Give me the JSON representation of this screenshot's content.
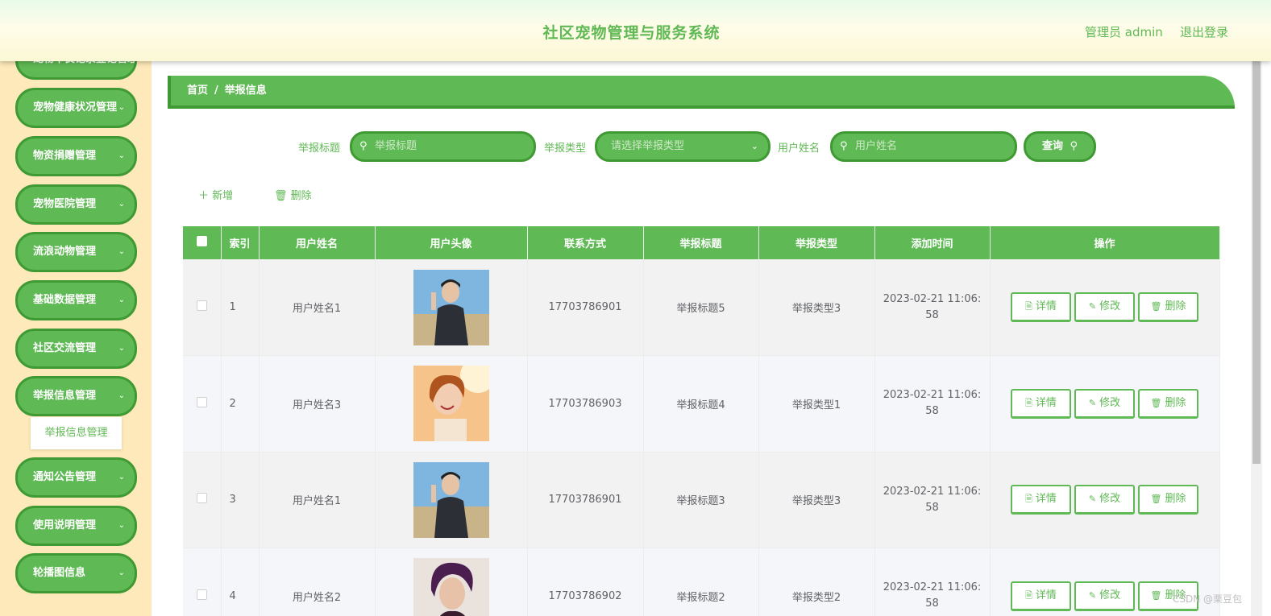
{
  "header": {
    "title": "社区宠物管理与服务系统",
    "admin": "管理员 admin",
    "logout": "退出登录"
  },
  "sidebar": {
    "items": [
      {
        "label": "宠物不良记录登记管理"
      },
      {
        "label": "宠物健康状况管理"
      },
      {
        "label": "物资捐赠管理"
      },
      {
        "label": "宠物医院管理"
      },
      {
        "label": "流浪动物管理"
      },
      {
        "label": "基础数据管理"
      },
      {
        "label": "社区交流管理"
      },
      {
        "label": "举报信息管理"
      },
      {
        "label": "通知公告管理"
      },
      {
        "label": "使用说明管理"
      },
      {
        "label": "轮播图信息"
      }
    ],
    "submenu": "举报信息管理"
  },
  "breadcrumb": {
    "home": "首页",
    "sep": "/",
    "current": "举报信息"
  },
  "search": {
    "title_label": "举报标题",
    "title_placeholder": "举报标题",
    "type_label": "举报类型",
    "type_placeholder": "请选择举报类型",
    "name_label": "用户姓名",
    "name_placeholder": "用户姓名",
    "query": "查询"
  },
  "actions": {
    "add": "新增",
    "delete": "删除"
  },
  "table": {
    "headers": [
      "索引",
      "用户姓名",
      "用户头像",
      "联系方式",
      "举报标题",
      "举报类型",
      "添加时间",
      "操作"
    ],
    "rows": [
      {
        "index": "1",
        "name": "用户姓名1",
        "phone": "17703786901",
        "title": "举报标题5",
        "type": "举报类型3",
        "time": "2023-02-21 11:06:58",
        "avatar": "avatar-1"
      },
      {
        "index": "2",
        "name": "用户姓名3",
        "phone": "17703786903",
        "title": "举报标题4",
        "type": "举报类型1",
        "time": "2023-02-21 11:06:58",
        "avatar": "avatar-3"
      },
      {
        "index": "3",
        "name": "用户姓名1",
        "phone": "17703786901",
        "title": "举报标题3",
        "type": "举报类型3",
        "time": "2023-02-21 11:06:58",
        "avatar": "avatar-1"
      },
      {
        "index": "4",
        "name": "用户姓名2",
        "phone": "17703786902",
        "title": "举报标题2",
        "type": "举报类型2",
        "time": "2023-02-21 11:06:58",
        "avatar": "avatar-2"
      }
    ],
    "ops": {
      "detail": "详情",
      "edit": "修改",
      "delete": "删除"
    }
  },
  "watermark": "CSDN @栗豆包",
  "colors": {
    "accent": "#5fb954",
    "accent_dark": "#3f9a34",
    "sidebar_bg": "#fde9b9"
  }
}
